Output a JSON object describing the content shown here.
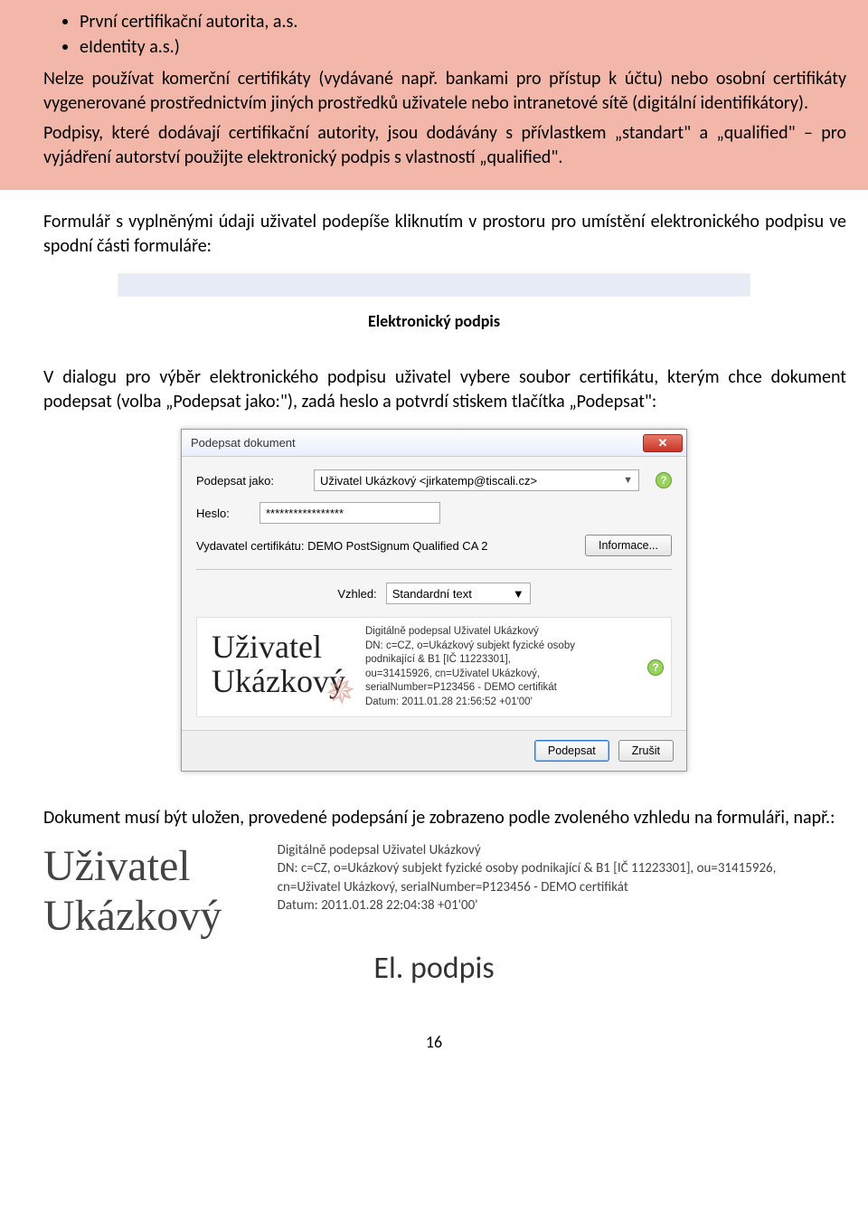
{
  "bullets": [
    "První certifikační autorita, a.s.",
    "eIdentity a.s.)"
  ],
  "pink": {
    "p1": "Nelze používat komerční certifikáty (vydávané např. bankami pro přístup k účtu) nebo osobní certifikáty vygenerované prostřednictvím jiných prostředků uživatele nebo intranetové sítě (digitální identifikátory).",
    "p2": "Podpisy, které dodávají certifikační autority, jsou dodávány s přívlastkem „standart\" a „qualified\" – pro vyjádření autorství použijte elektronický podpis s vlastností „qualified\"."
  },
  "para1": "Formulář s vyplněnými údaji uživatel podepíše kliknutím v prostoru pro umístění elektronického podpisu ve spodní části formuláře:",
  "strip_caption": "Elektronický podpis",
  "para2": "V dialogu pro výběr elektronického podpisu uživatel vybere soubor certifikátu, kterým chce dokument podepsat (volba „Podepsat jako:\"), zadá heslo a potvrdí stiskem tlačítka „Podepsat\":",
  "dialog": {
    "title": "Podepsat dokument",
    "sign_as_label": "Podepsat jako:",
    "sign_as_value": "Uživatel Ukázkový <jirkatemp@tiscali.cz>",
    "password_label": "Heslo:",
    "password_value": "*****************",
    "issuer_label": "Vydavatel certifikátu: DEMO PostSignum Qualified CA 2",
    "info_btn": "Informace...",
    "look_label": "Vzhled:",
    "look_value": "Standardní text",
    "preview_name_l1": "Uživatel",
    "preview_name_l2": "Ukázkový",
    "preview_details_l1": "Digitálně podepsal Uživatel Ukázkový",
    "preview_details_l2": "DN: c=CZ, o=Ukázkový subjekt fyzické osoby podnikající & B1 [IČ 11223301],",
    "preview_details_l3": "ou=31415926, cn=Uživatel Ukázkový, serialNumber=P123456 - DEMO certifikát",
    "preview_details_l4": "Datum: 2011.01.28 21:56:52 +01'00'",
    "sign_btn": "Podepsat",
    "cancel_btn": "Zrušit"
  },
  "para3": "Dokument musí být uložen, provedené podepsání je zobrazeno podle zvoleného vzhledu na formuláři, např.:",
  "sig": {
    "name": "Uživatel Ukázkový",
    "d1": "Digitálně podepsal Uživatel Ukázkový",
    "d2": "DN: c=CZ, o=Ukázkový subjekt fyzické osoby podnikající & B1 [IČ 11223301], ou=31415926, cn=Uživatel Ukázkový, serialNumber=P123456 - DEMO certifikát",
    "d3": "Datum: 2011.01.28 22:04:38 +01'00'",
    "el_label": "El. podpis"
  },
  "page_number": "16"
}
